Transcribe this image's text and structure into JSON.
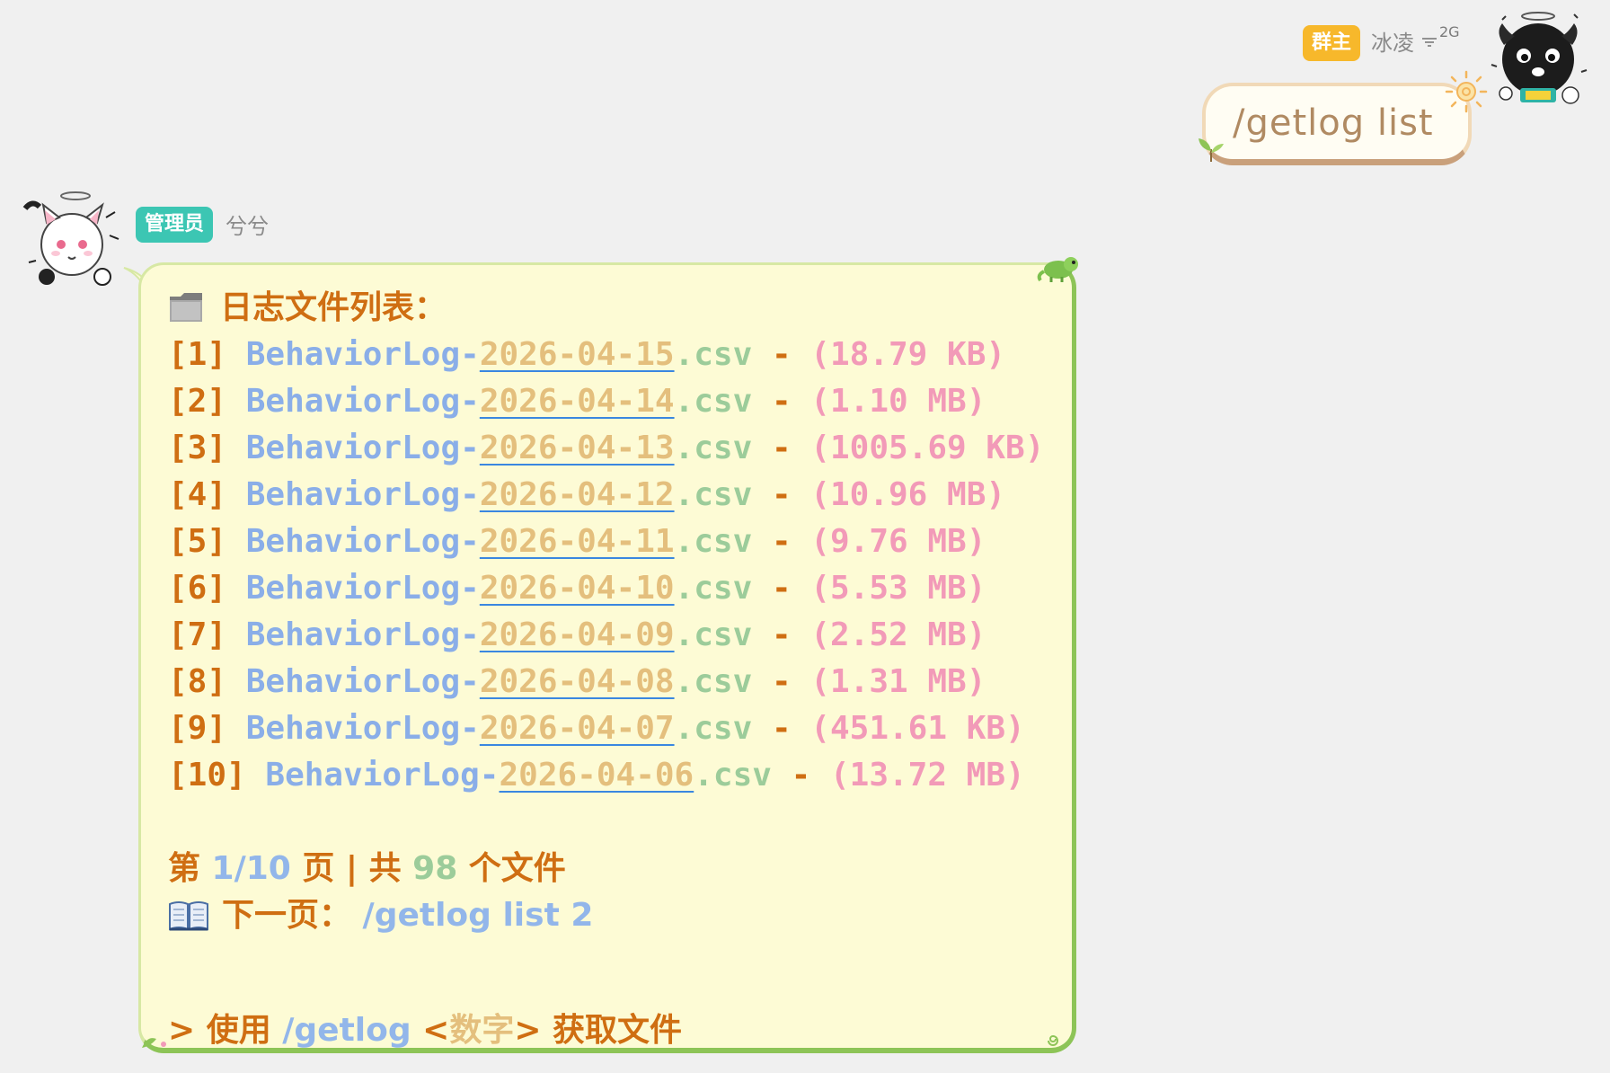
{
  "sender": {
    "badge": "群主",
    "name": "冰凌",
    "network": "2G",
    "message": "/getlog list"
  },
  "bot": {
    "badge": "管理员",
    "name": "兮兮",
    "title": "日志文件列表：",
    "files": [
      {
        "idx": "[1]",
        "prefix": "BehaviorLog-",
        "date": "2026-04-15",
        "ext": ".csv",
        "sep": " - ",
        "size": "(18.79 KB)"
      },
      {
        "idx": "[2]",
        "prefix": "BehaviorLog-",
        "date": "2026-04-14",
        "ext": ".csv",
        "sep": " - ",
        "size": "(1.10 MB)"
      },
      {
        "idx": "[3]",
        "prefix": "BehaviorLog-",
        "date": "2026-04-13",
        "ext": ".csv",
        "sep": " - ",
        "size": "(1005.69 KB)"
      },
      {
        "idx": "[4]",
        "prefix": "BehaviorLog-",
        "date": "2026-04-12",
        "ext": ".csv",
        "sep": " - ",
        "size": "(10.96 MB)"
      },
      {
        "idx": "[5]",
        "prefix": "BehaviorLog-",
        "date": "2026-04-11",
        "ext": ".csv",
        "sep": " - ",
        "size": "(9.76 MB)"
      },
      {
        "idx": "[6]",
        "prefix": "BehaviorLog-",
        "date": "2026-04-10",
        "ext": ".csv",
        "sep": " - ",
        "size": "(5.53 MB)"
      },
      {
        "idx": "[7]",
        "prefix": "BehaviorLog-",
        "date": "2026-04-09",
        "ext": ".csv",
        "sep": " - ",
        "size": "(2.52 MB)"
      },
      {
        "idx": "[8]",
        "prefix": "BehaviorLog-",
        "date": "2026-04-08",
        "ext": ".csv",
        "sep": " - ",
        "size": "(1.31 MB)"
      },
      {
        "idx": "[9]",
        "prefix": "BehaviorLog-",
        "date": "2026-04-07",
        "ext": ".csv",
        "sep": " - ",
        "size": "(451.61 KB)"
      },
      {
        "idx": "[10]",
        "prefix": "BehaviorLog-",
        "date": "2026-04-06",
        "ext": ".csv",
        "sep": " - ",
        "size": "(13.72 MB)"
      }
    ],
    "page_info": {
      "prefix": "第 ",
      "page": "1/10",
      "mid": " 页 | 共 ",
      "count": "98",
      "suffix": " 个文件"
    },
    "next_page": {
      "label": "下一页：",
      "command": " /getlog list 2"
    },
    "usage": {
      "prefix": "> 使用 ",
      "command": "/getlog",
      "arg_open": " <",
      "arg": "数字",
      "arg_close": ">",
      "suffix": " 获取文件"
    }
  },
  "icons": {
    "title": "folder-icon",
    "next": "open-book-icon"
  },
  "colors": {
    "background": "#f0f0f0",
    "bot_bubble": "#fdfbd5",
    "bot_border": "#8dc457",
    "text_orange": "#cf6e12",
    "owner_badge": "#f7b82b",
    "admin_badge": "#3cc6b3"
  }
}
